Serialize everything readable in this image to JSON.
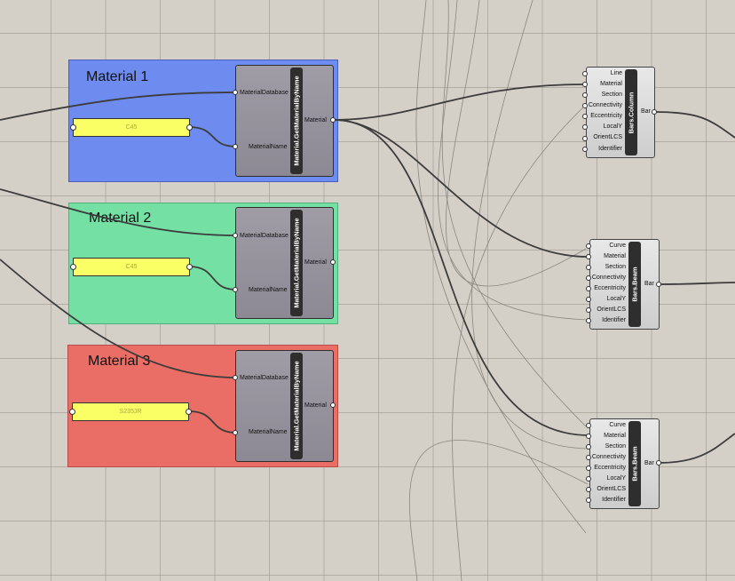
{
  "colors": {
    "canvas": "#d4d0c8",
    "group_blue": "#6e8cf0",
    "group_green": "#74e0a4",
    "group_red": "#ea6d66",
    "panel_yellow": "#fbff66",
    "component_body": "#9a96a0",
    "wire": "#3c3c3c"
  },
  "groups": [
    {
      "title": "Material 1",
      "panel_value": "C45"
    },
    {
      "title": "Material 2",
      "panel_value": "C45"
    },
    {
      "title": "Material 3",
      "panel_value": "S235JR"
    }
  ],
  "get_material_component": {
    "name": "Material.GetMaterialByName",
    "inputs": [
      "MaterialDatabase",
      "MaterialName"
    ],
    "output": "Material"
  },
  "bars_column": {
    "name": "Bars.Column",
    "inputs": [
      "Line",
      "Material",
      "Section",
      "Connectivity",
      "Eccentricity",
      "LocalY",
      "OrientLCS",
      "Identifier"
    ],
    "output": "Bar"
  },
  "bars_beam_1": {
    "name": "Bars.Beam",
    "inputs": [
      "Curve",
      "Material",
      "Section",
      "Connectivity",
      "Eccentricity",
      "LocalY",
      "OrientLCS",
      "Identifier"
    ],
    "output": "Bar"
  },
  "bars_beam_2": {
    "name": "Bars.Beam",
    "inputs": [
      "Curve",
      "Material",
      "Section",
      "Connectivity",
      "Eccentricity",
      "LocalY",
      "OrientLCS",
      "Identifier"
    ],
    "output": "Bar"
  }
}
